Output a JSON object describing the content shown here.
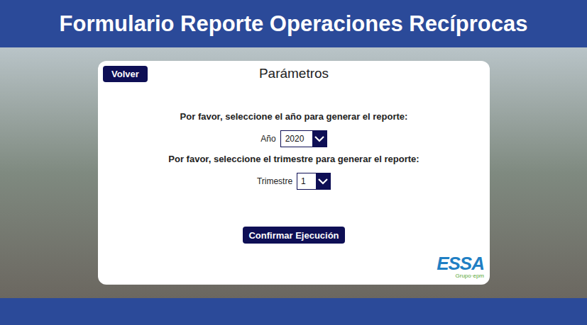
{
  "header": {
    "title": "Formulario Reporte Operaciones Recíprocas"
  },
  "card": {
    "back_button": "Volver",
    "title": "Parámetros",
    "fields": [
      {
        "prompt": "Por favor, seleccione el año para generar el reporte:",
        "label": "Año",
        "value": "2020"
      },
      {
        "prompt": "Por favor, seleccione el trimestre para generar el reporte:",
        "label": "Trimestre",
        "value": "1"
      }
    ],
    "submit_button": "Confirmar Ejecución"
  },
  "logo": {
    "name": "ESSA",
    "subtitle": "Grupo·epm"
  }
}
